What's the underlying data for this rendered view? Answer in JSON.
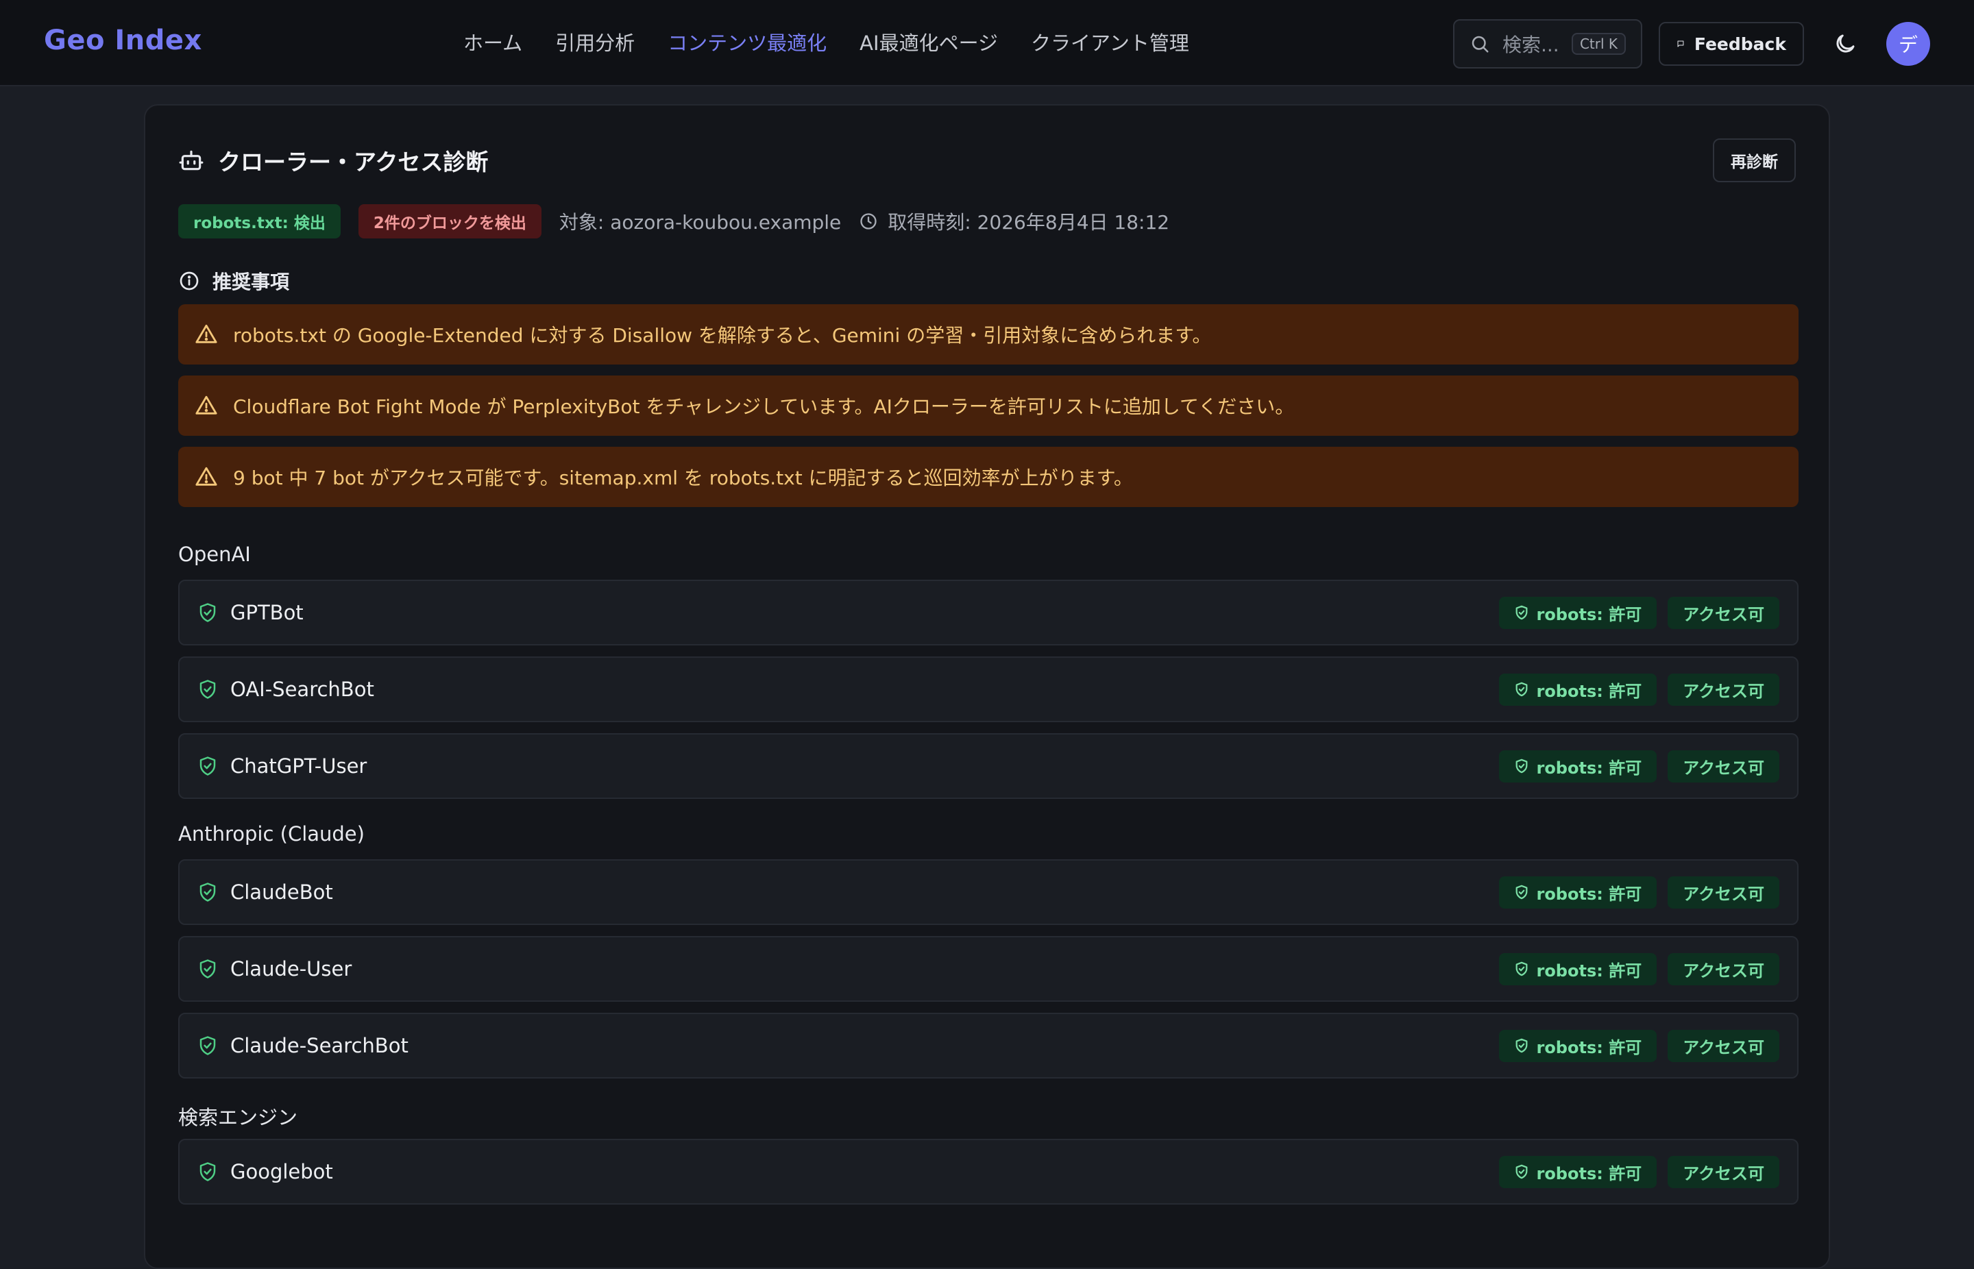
{
  "app": {
    "logo": "Geo Index"
  },
  "nav": [
    {
      "label": "ホーム",
      "active": false
    },
    {
      "label": "引用分析",
      "active": false
    },
    {
      "label": "コンテンツ最適化",
      "active": true
    },
    {
      "label": "AI最適化ページ",
      "active": false
    },
    {
      "label": "クライアント管理",
      "active": false
    }
  ],
  "header": {
    "search_placeholder": "検索...",
    "search_shortcut": "Ctrl K",
    "feedback_label": "Feedback",
    "avatar_initial": "デ"
  },
  "card": {
    "title": "クローラー・アクセス診断",
    "rediag_label": "再診断",
    "robots_badge": "robots.txt: 検出",
    "block_badge": "2件のブロックを検出",
    "target": "対象: aozora-koubou.example",
    "fetched_at": "取得時刻: 2026年8月4日 18:12",
    "recommendations_title": "推奨事項",
    "recommendations": [
      "robots.txt の Google-Extended に対する Disallow を解除すると、Gemini の学習・引用対象に含められます。",
      "Cloudflare Bot Fight Mode が PerplexityBot をチャレンジしています。AIクローラーを許可リストに追加してください。",
      "9 bot 中 7 bot がアクセス可能です。sitemap.xml を robots.txt に明記すると巡回効率が上がります。"
    ]
  },
  "groups": [
    {
      "title": "OpenAI",
      "bots": [
        {
          "name": "GPTBot",
          "robots": "robots: 許可",
          "access": "アクセス可"
        },
        {
          "name": "OAI-SearchBot",
          "robots": "robots: 許可",
          "access": "アクセス可"
        },
        {
          "name": "ChatGPT-User",
          "robots": "robots: 許可",
          "access": "アクセス可"
        }
      ]
    },
    {
      "title": "Anthropic (Claude)",
      "bots": [
        {
          "name": "ClaudeBot",
          "robots": "robots: 許可",
          "access": "アクセス可"
        },
        {
          "name": "Claude-User",
          "robots": "robots: 許可",
          "access": "アクセス可"
        },
        {
          "name": "Claude-SearchBot",
          "robots": "robots: 許可",
          "access": "アクセス可"
        }
      ]
    },
    {
      "title": "検索エンジン",
      "bots": [
        {
          "name": "Googlebot",
          "robots": "robots: 許可",
          "access": "アクセス可"
        }
      ]
    }
  ],
  "colors": {
    "accent": "#6c6ff2",
    "ok": "#7be0a6",
    "warn": "#f4c77a",
    "danger": "#f19a9a"
  }
}
